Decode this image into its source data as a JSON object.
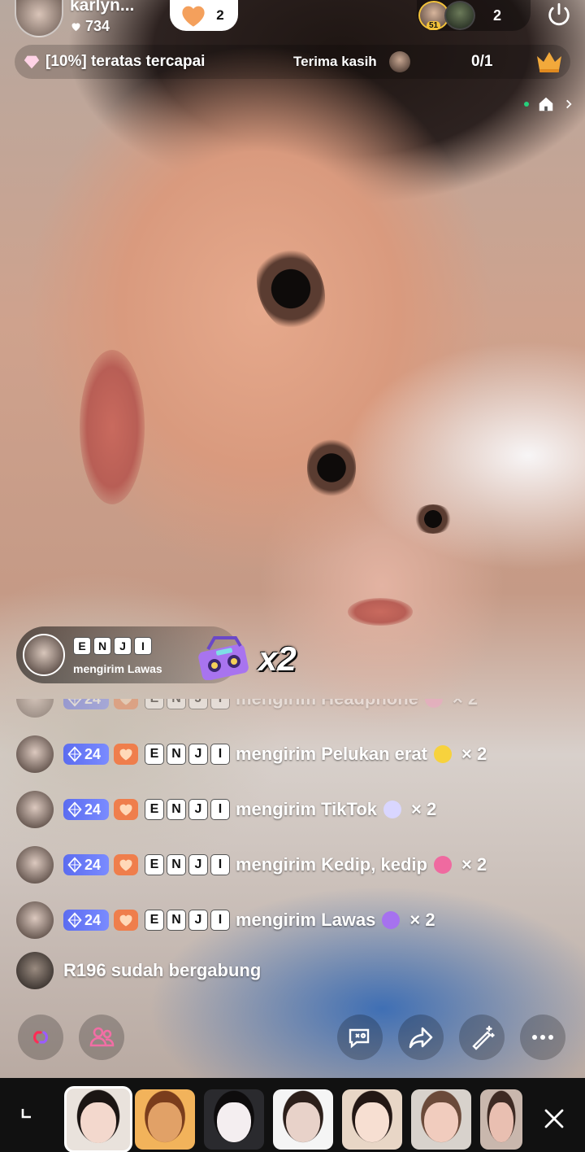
{
  "host": {
    "name": "karlyn...",
    "likes": "734"
  },
  "heart_pill": {
    "count": "2"
  },
  "viewers": {
    "top_rank": "51",
    "count": "2"
  },
  "goal": {
    "text": "[10%] teratas tercapai",
    "thanks_label": "Terima kasih",
    "progress": "0/1"
  },
  "gift_banner": {
    "sender_tiles": [
      "E",
      "N",
      "J",
      "I"
    ],
    "action": "mengirim Lawas",
    "multiplier": "x2"
  },
  "chat": [
    {
      "level": "24",
      "sender_tiles": [
        "E",
        "N",
        "J",
        "I"
      ],
      "text": "mengirim Headphone",
      "emoji_color": "#f4a1c8",
      "multiplier": "× 2",
      "faded": true
    },
    {
      "level": "24",
      "sender_tiles": [
        "E",
        "N",
        "J",
        "I"
      ],
      "text": "mengirim Pelukan erat",
      "emoji_color": "#f7d23d",
      "multiplier": "× 2",
      "faded": false
    },
    {
      "level": "24",
      "sender_tiles": [
        "E",
        "N",
        "J",
        "I"
      ],
      "text": "mengirim TikTok",
      "emoji_color": "#d9d6ff",
      "multiplier": "× 2",
      "faded": false
    },
    {
      "level": "24",
      "sender_tiles": [
        "E",
        "N",
        "J",
        "I"
      ],
      "text": "mengirim Kedip, kedip",
      "emoji_color": "#ef6aa0",
      "multiplier": "× 2",
      "faded": false
    },
    {
      "level": "24",
      "sender_tiles": [
        "E",
        "N",
        "J",
        "I"
      ],
      "text": "mengirim Lawas",
      "emoji_color": "#a672ef",
      "multiplier": "× 2",
      "faded": false
    }
  ],
  "join": {
    "text": "R196 sudah bergabung"
  },
  "controls": [
    "link-icon",
    "guests-icon",
    "comment-icon",
    "share-icon",
    "magic-wand-icon",
    "more-icon"
  ],
  "colors": {
    "accent_pink": "#fe2c55",
    "accent_cyan": "#25f4ee",
    "level_badge": "#5b6cf0",
    "fan_badge": "#ef7e4c"
  },
  "effects": [
    {
      "name": "effect-1",
      "selected": true,
      "skin": "#f3d8cd",
      "hair": "#1b1513",
      "bg": "#e9e2dc"
    },
    {
      "name": "effect-2",
      "selected": false,
      "skin": "#e1a167",
      "hair": "#7a3d1c",
      "bg": "#f2b35b"
    },
    {
      "name": "effect-3",
      "selected": false,
      "skin": "#f4eef0",
      "hair": "#0e0c0d",
      "bg": "#2a2a2e"
    },
    {
      "name": "effect-4",
      "selected": false,
      "skin": "#e8d2c9",
      "hair": "#2c1f1a",
      "bg": "#f5f5f5"
    },
    {
      "name": "effect-5",
      "selected": false,
      "skin": "#f7dfd2",
      "hair": "#231714",
      "bg": "#e8d6c6"
    },
    {
      "name": "effect-6",
      "selected": false,
      "skin": "#f1ccbe",
      "hair": "#6b4a3a",
      "bg": "#d8d2cc"
    },
    {
      "name": "effect-7",
      "selected": false,
      "skin": "#e9bfb1",
      "hair": "#3e2a23",
      "bg": "#c9b7ad"
    }
  ]
}
